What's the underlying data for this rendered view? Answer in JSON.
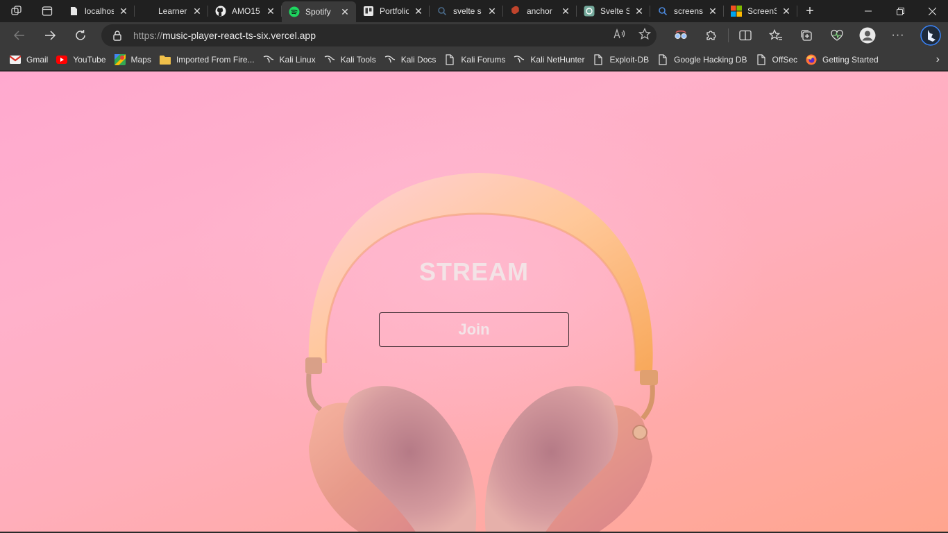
{
  "browser": {
    "tabs": [
      {
        "title": "localhos",
        "icon": "page-icon",
        "active": false
      },
      {
        "title": "Learner",
        "icon": "blank-icon",
        "active": false
      },
      {
        "title": "AMO15",
        "icon": "github-icon",
        "active": false
      },
      {
        "title": "Spotify",
        "icon": "spotify-icon",
        "active": true
      },
      {
        "title": "Portfolio",
        "icon": "trello-icon",
        "active": false
      },
      {
        "title": "svelte s",
        "icon": "search-icon",
        "active": false
      },
      {
        "title": "anchor",
        "icon": "svelte-icon",
        "active": false
      },
      {
        "title": "Svelte S",
        "icon": "chatgpt-icon",
        "active": false
      },
      {
        "title": "screens",
        "icon": "search-icon",
        "active": false
      },
      {
        "title": "ScreenS",
        "icon": "microsoft-icon",
        "active": false
      }
    ],
    "address": {
      "scheme": "https://",
      "host": "music-player-react-ts-six.vercel.app"
    },
    "bookmarks": [
      {
        "label": "Gmail",
        "icon": "gmail-icon"
      },
      {
        "label": "YouTube",
        "icon": "youtube-icon"
      },
      {
        "label": "Maps",
        "icon": "maps-icon"
      },
      {
        "label": "Imported From Fire...",
        "icon": "folder-icon"
      },
      {
        "label": "Kali Linux",
        "icon": "kali-icon"
      },
      {
        "label": "Kali Tools",
        "icon": "kali-icon"
      },
      {
        "label": "Kali Docs",
        "icon": "kali-icon"
      },
      {
        "label": "Kali Forums",
        "icon": "page-icon"
      },
      {
        "label": "Kali NetHunter",
        "icon": "kali-icon"
      },
      {
        "label": "Exploit-DB",
        "icon": "page-icon"
      },
      {
        "label": "Google Hacking DB",
        "icon": "page-icon"
      },
      {
        "label": "OffSec",
        "icon": "page-icon"
      },
      {
        "label": "Getting Started",
        "icon": "firefox-icon"
      }
    ]
  },
  "page": {
    "title": "STREAM",
    "join_label": "Join"
  },
  "colors": {
    "background_top": "#ffa9cf",
    "background_bottom": "#ffa58e",
    "title": "#f3e3e6",
    "button_border": "#3a2a2f"
  }
}
